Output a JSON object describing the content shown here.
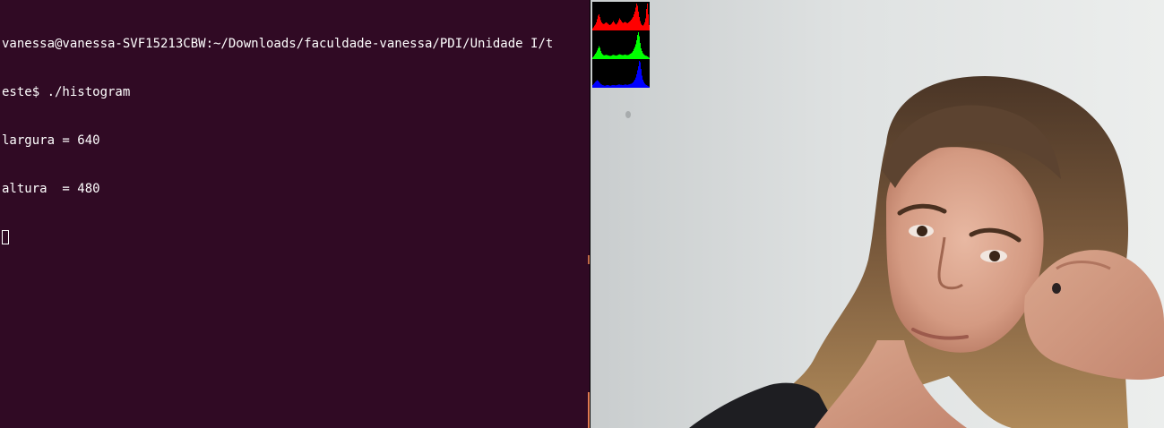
{
  "terminal": {
    "lines": [
      "vanessa@vanessa-SVF15213CBW:~/Downloads/faculdade-vanessa/PDI/Unidade I/t",
      "este$ ./histogram",
      "largura = 640",
      "altura  = 480"
    ],
    "background_color": "#300a24",
    "text_color": "#ffffff"
  },
  "camera": {
    "content": "webcam-frame"
  },
  "histogram": {
    "channels": [
      {
        "color": "#ff0000",
        "bins": [
          0.08,
          0.12,
          0.18,
          0.22,
          0.3,
          0.42,
          0.55,
          0.6,
          0.5,
          0.38,
          0.3,
          0.26,
          0.24,
          0.25,
          0.28,
          0.3,
          0.28,
          0.25,
          0.22,
          0.2,
          0.22,
          0.25,
          0.3,
          0.35,
          0.3,
          0.25,
          0.22,
          0.25,
          0.3,
          0.38,
          0.45,
          0.4,
          0.35,
          0.3,
          0.28,
          0.3,
          0.32,
          0.3,
          0.28,
          0.27,
          0.3,
          0.33,
          0.36,
          0.4,
          0.45,
          0.5,
          0.6,
          0.7,
          0.85,
          1.0,
          0.92,
          0.7,
          0.5,
          0.35,
          0.25,
          0.2,
          0.18,
          0.22,
          0.3,
          0.45,
          0.8,
          1.0,
          0.6,
          0.2
        ]
      },
      {
        "color": "#00ff00",
        "bins": [
          0.06,
          0.1,
          0.15,
          0.2,
          0.25,
          0.32,
          0.4,
          0.48,
          0.42,
          0.3,
          0.22,
          0.18,
          0.15,
          0.14,
          0.15,
          0.16,
          0.15,
          0.14,
          0.13,
          0.12,
          0.12,
          0.13,
          0.15,
          0.16,
          0.15,
          0.14,
          0.13,
          0.14,
          0.15,
          0.17,
          0.18,
          0.17,
          0.16,
          0.15,
          0.15,
          0.16,
          0.17,
          0.16,
          0.15,
          0.15,
          0.16,
          0.18,
          0.2,
          0.22,
          0.25,
          0.3,
          0.38,
          0.45,
          0.55,
          0.7,
          0.9,
          1.0,
          0.85,
          0.6,
          0.4,
          0.3,
          0.22,
          0.18,
          0.15,
          0.13,
          0.12,
          0.1,
          0.08,
          0.05
        ]
      },
      {
        "color": "#0000ff",
        "bins": [
          0.1,
          0.14,
          0.18,
          0.22,
          0.25,
          0.28,
          0.26,
          0.22,
          0.18,
          0.14,
          0.12,
          0.1,
          0.09,
          0.08,
          0.08,
          0.09,
          0.1,
          0.1,
          0.09,
          0.08,
          0.08,
          0.09,
          0.1,
          0.1,
          0.1,
          0.09,
          0.09,
          0.1,
          0.11,
          0.12,
          0.12,
          0.11,
          0.11,
          0.1,
          0.1,
          0.11,
          0.12,
          0.12,
          0.11,
          0.11,
          0.12,
          0.13,
          0.14,
          0.15,
          0.17,
          0.2,
          0.25,
          0.3,
          0.38,
          0.5,
          0.65,
          0.8,
          1.0,
          0.95,
          0.7,
          0.45,
          0.3,
          0.22,
          0.16,
          0.12,
          0.1,
          0.08,
          0.06,
          0.04
        ]
      }
    ]
  }
}
